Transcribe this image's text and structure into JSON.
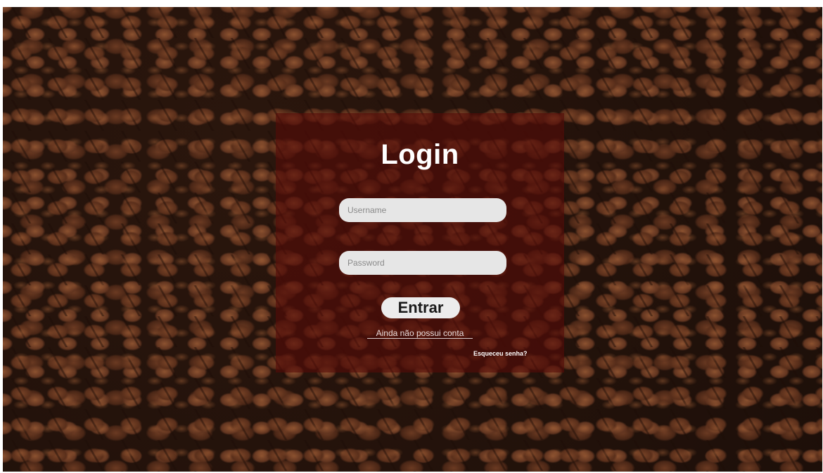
{
  "login": {
    "title": "Login",
    "username_placeholder": "Username",
    "password_placeholder": "Password",
    "submit_label": "Entrar",
    "register_link": "Ainda não possui conta",
    "forgot_link": "Esqueceu senha?"
  },
  "colors": {
    "panel_overlay": "#550c08",
    "input_background": "#e6e6e6",
    "button_background": "#ececec",
    "title_text": "#ffffff"
  }
}
